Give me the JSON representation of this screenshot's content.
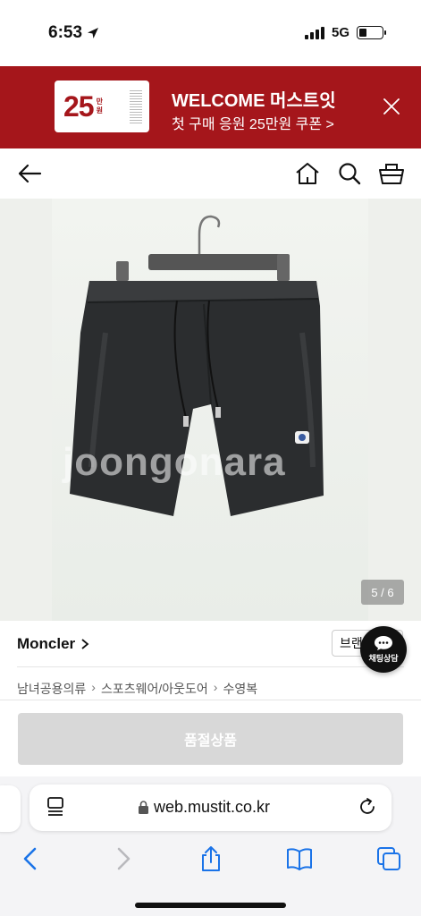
{
  "status_bar": {
    "time": "6:53",
    "network": "5G"
  },
  "promo": {
    "coupon_amount": "25",
    "coupon_unit_top": "만",
    "coupon_unit_bottom": "원",
    "title": "WELCOME 머스트잇",
    "subtitle": "첫 구매 응원 25만원 쿠폰 >"
  },
  "gallery": {
    "counter": "5 / 6",
    "watermark": "joongonara"
  },
  "product": {
    "brand": "Moncler",
    "brand_button": "브랜",
    "breadcrumb": [
      "남녀공용의류",
      "스포츠웨어/아웃도어",
      "수영복"
    ],
    "sold_out_label": "품절상품"
  },
  "chat": {
    "label": "채팅상담"
  },
  "browser": {
    "url": "web.mustit.co.kr"
  },
  "colors": {
    "brand_red": "#a5161b",
    "sold_out_gray": "#d8d8d8",
    "ios_blue": "#1a73e8"
  }
}
